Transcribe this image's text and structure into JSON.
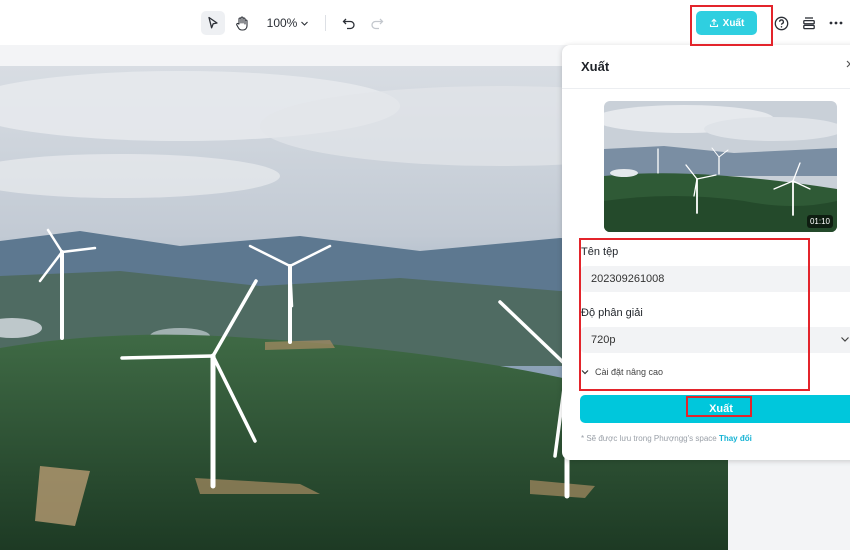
{
  "toolbar": {
    "zoom_label": "100%",
    "export_label": "Xuất"
  },
  "export_panel": {
    "title": "Xuất",
    "preview_duration": "01:10",
    "filename_label": "Tên tệp",
    "filename_value": "202309261008",
    "resolution_label": "Độ phân giải",
    "resolution_value": "720p",
    "advanced_label": "Cài đặt nâng cao",
    "export_button_label": "Xuất",
    "save_note": "* Sẽ được lưu trong Phượngg's space",
    "change_link": "Thay đổi"
  },
  "colors": {
    "accent": "#00c7dc",
    "highlight": "#e3242b"
  }
}
